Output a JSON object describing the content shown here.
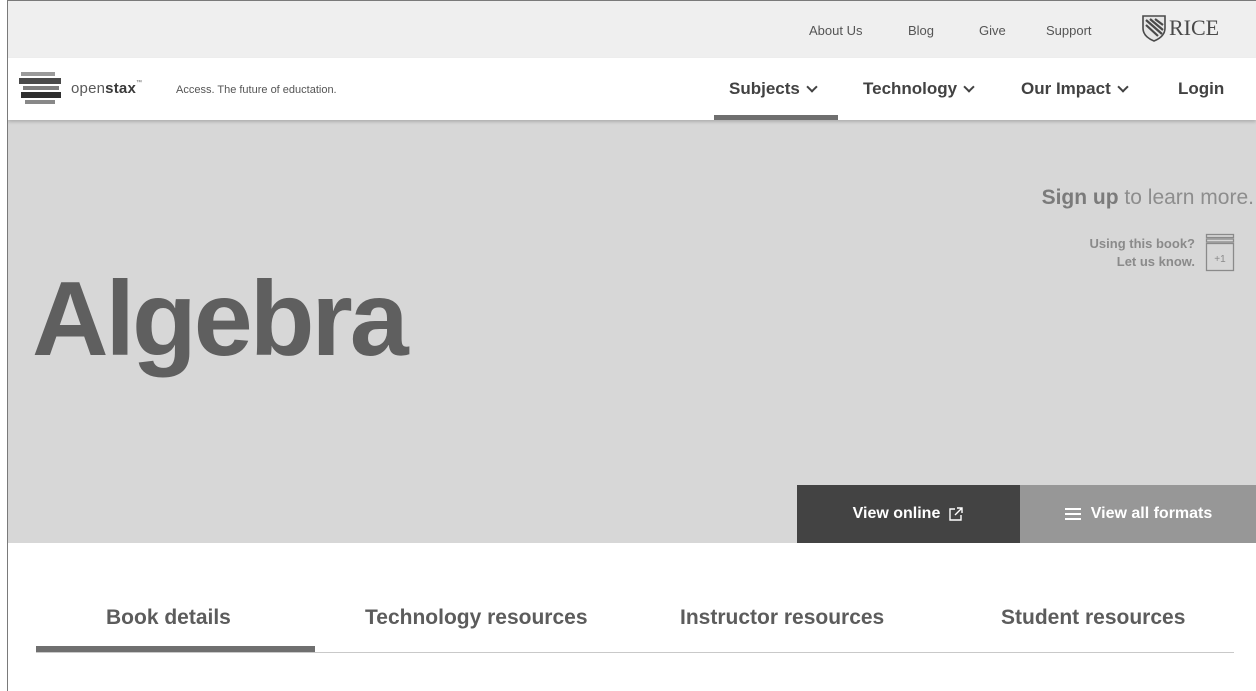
{
  "utility_nav": {
    "links": [
      "About Us",
      "Blog",
      "Give",
      "Support"
    ],
    "rice_logo_text": "RICE"
  },
  "main_nav": {
    "logo_text_light": "open",
    "logo_text_bold": "stax",
    "logo_tm": "™",
    "tagline": "Access. The future of eductation.",
    "items": [
      "Subjects",
      "Technology",
      "Our Impact"
    ],
    "login": "Login",
    "active_item": "Subjects"
  },
  "hero": {
    "title": "Algebra",
    "signup_bold": "Sign up",
    "signup_rest": " to learn more.",
    "using_line1": "Using this book?",
    "using_line2": "Let us know.",
    "badge_text": "+1",
    "btn_online": "View online",
    "btn_formats": "View all formats",
    "background_color": "#d7d7d7"
  },
  "tabs": {
    "items": [
      "Book details",
      "Technology resources",
      "Instructor resources",
      "Student resources"
    ],
    "active": "Book details"
  },
  "icons": {
    "rice_shield": "shield-icon",
    "external_link": "external-link-icon",
    "menu": "hamburger-icon",
    "book_add": "book-plus-icon"
  }
}
